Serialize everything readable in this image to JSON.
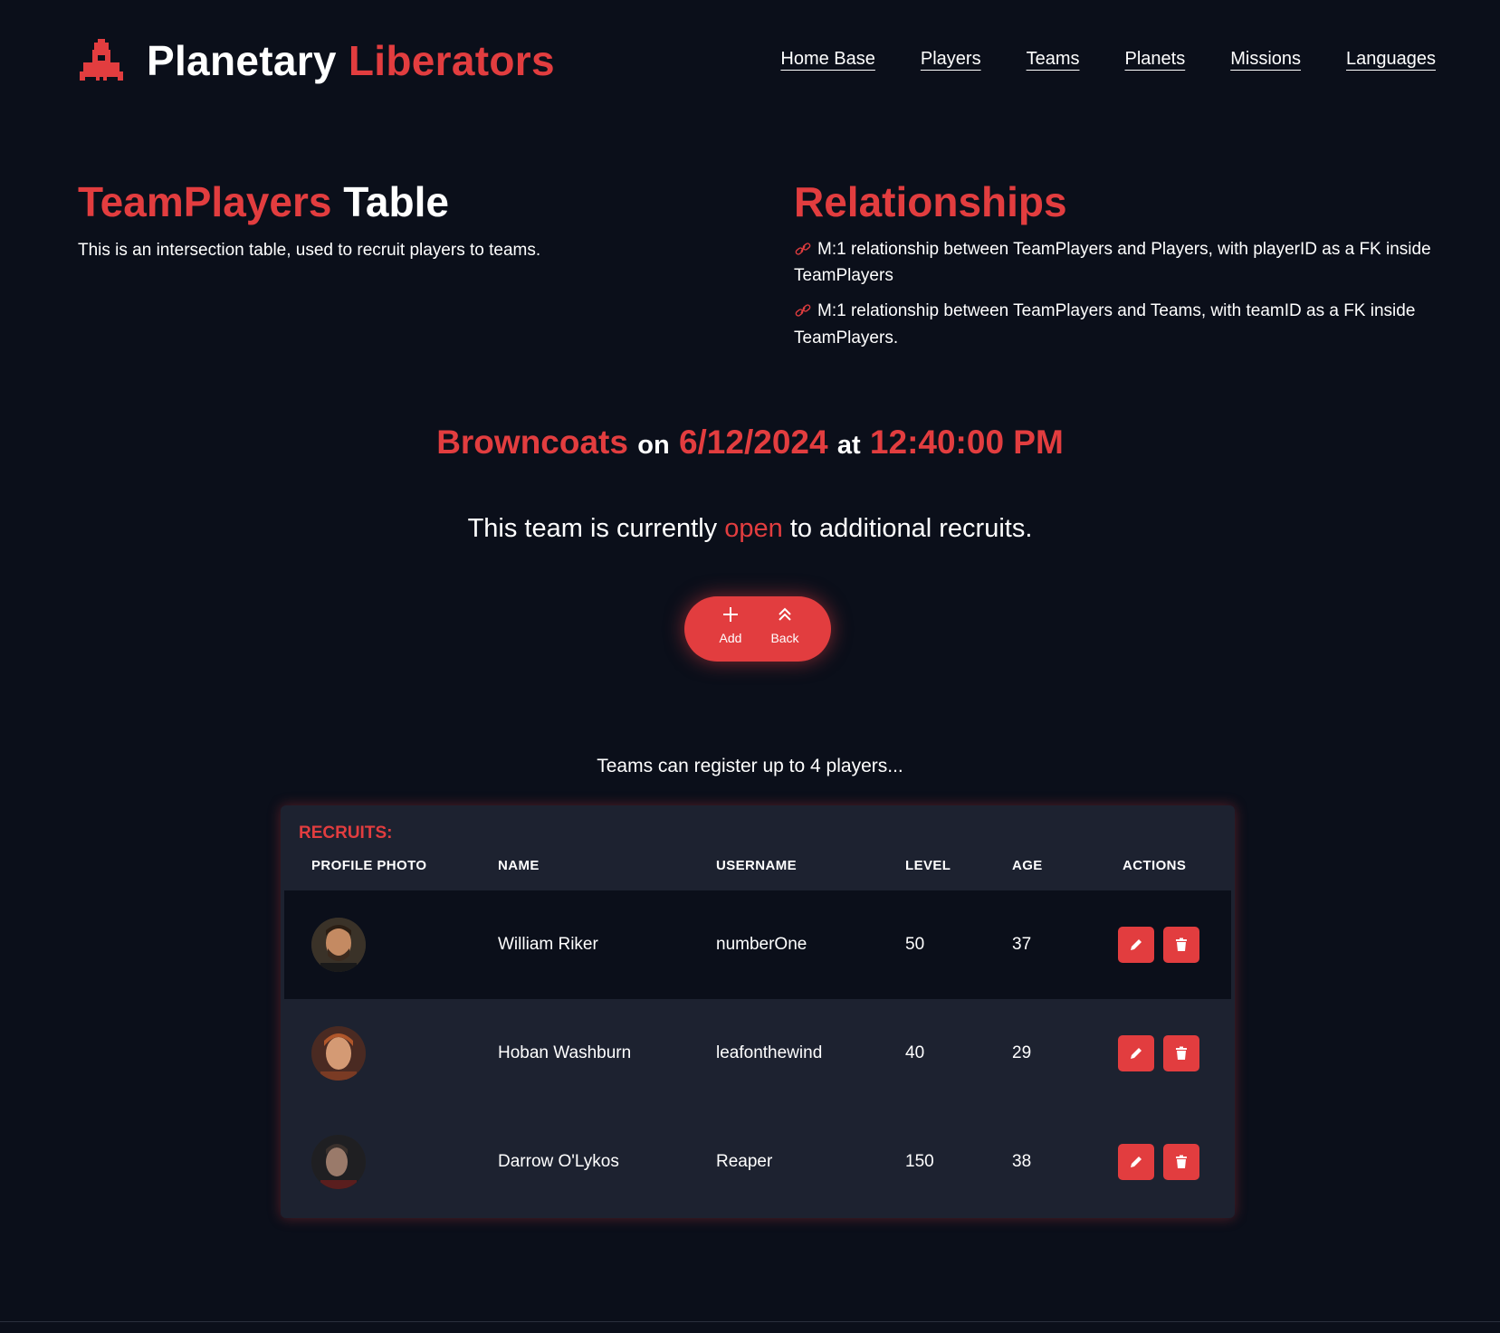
{
  "brand": {
    "word1": "Planetary",
    "word2": "Liberators",
    "icon": "rocket-icon"
  },
  "nav": [
    "Home Base",
    "Players",
    "Teams",
    "Planets",
    "Missions",
    "Languages"
  ],
  "table_section": {
    "title_accent": "TeamPlayers",
    "title_rest": "Table",
    "description": "This is an intersection table, used to recruit players to teams."
  },
  "relationships": {
    "title": "Relationships",
    "items": [
      "M:1 relationship between TeamPlayers and Players, with playerID as a FK inside TeamPlayers",
      "M:1 relationship between TeamPlayers and Teams, with teamID as a FK inside TeamPlayers."
    ]
  },
  "headline": {
    "team": "Browncoats",
    "on": "on",
    "date": "6/12/2024",
    "at": "at",
    "time": "12:40:00 PM"
  },
  "status": {
    "before": "This team is currently",
    "state": "open",
    "after": "to additional recruits."
  },
  "pill": {
    "add_label": "Add",
    "back_label": "Back"
  },
  "note": "Teams can register up to 4 players...",
  "recruits": {
    "title": "RECRUITS:",
    "columns": [
      "PROFILE PHOTO",
      "NAME",
      "USERNAME",
      "LEVEL",
      "AGE",
      "ACTIONS"
    ],
    "rows": [
      {
        "name": "William Riker",
        "username": "numberOne",
        "level": "50",
        "age": "37"
      },
      {
        "name": "Hoban Washburn",
        "username": "leafonthewind",
        "level": "40",
        "age": "29"
      },
      {
        "name": "Darrow O'Lykos",
        "username": "Reaper",
        "level": "150",
        "age": "38"
      }
    ]
  },
  "colors": {
    "accent": "#e23d3f",
    "background": "#0b0f1a",
    "card": "#1d2230"
  }
}
